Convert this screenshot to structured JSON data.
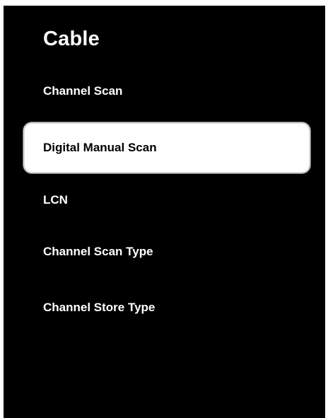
{
  "title": "Cable",
  "menu": {
    "items": [
      {
        "label": "Channel Scan",
        "selected": false
      },
      {
        "label": "Digital Manual Scan",
        "selected": true
      },
      {
        "label": "LCN",
        "selected": false
      },
      {
        "label": "Channel Scan Type",
        "selected": false
      },
      {
        "label": "Channel Store Type",
        "selected": false
      }
    ]
  },
  "colors": {
    "background": "#000000",
    "text": "#ffffff",
    "highlight_background": "#ffffff",
    "highlight_text": "#000000"
  }
}
